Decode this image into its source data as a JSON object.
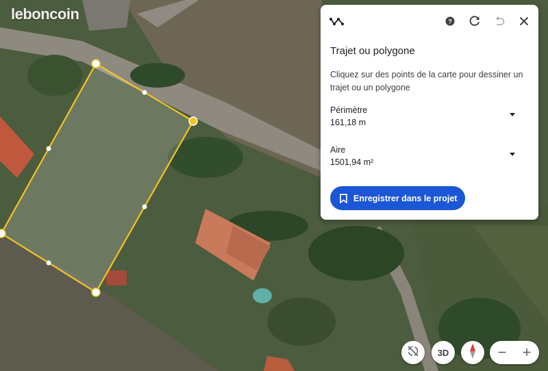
{
  "brand": {
    "watermark": "leboncoin"
  },
  "panel": {
    "title": "Trajet ou polygone",
    "description": "Cliquez sur des points de la carte pour dessiner un trajet ou un polygone",
    "perimeter": {
      "label": "Périmètre",
      "value": "161,18 m"
    },
    "area": {
      "label": "Aire",
      "value": "1501,94 m²"
    },
    "save_button": "Enregistrer dans le projet",
    "header_icons": [
      "path-measure-icon",
      "help-icon",
      "refresh-icon",
      "undo-icon",
      "close-icon"
    ]
  },
  "map_controls": {
    "three_d_label": "3D",
    "zoom_out": "−",
    "zoom_in": "+"
  },
  "colors": {
    "polygon_stroke": "#f2c523",
    "button_blue": "#1a56d6"
  }
}
